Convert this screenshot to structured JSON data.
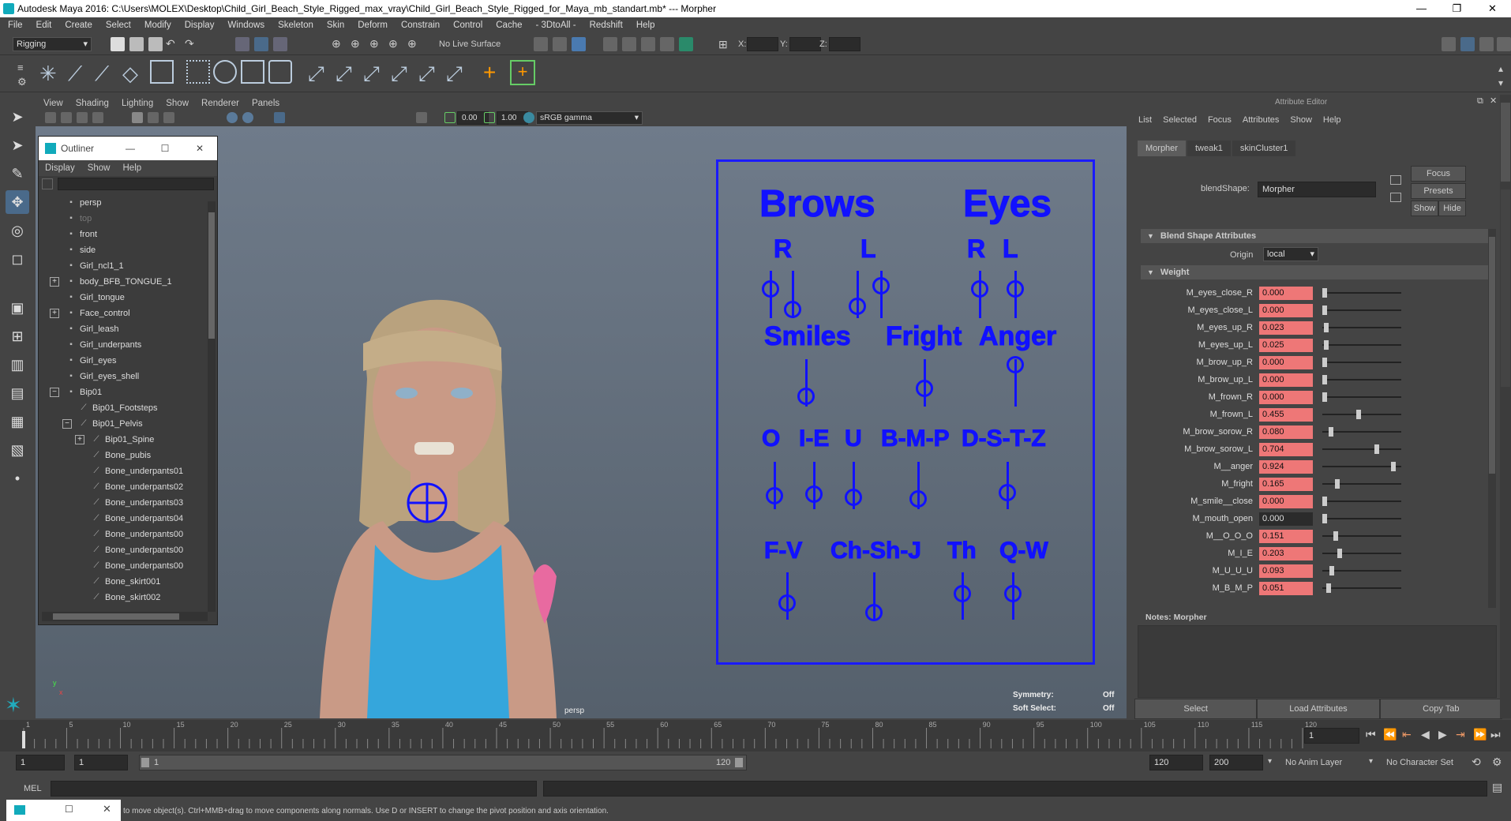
{
  "window": {
    "title": "Autodesk Maya 2016: C:\\Users\\MOLEX\\Desktop\\Child_Girl_Beach_Style_Rigged_max_vray\\Child_Girl_Beach_Style_Rigged_for_Maya_mb_standart.mb*  ---  Morpher"
  },
  "menubar": [
    "File",
    "Edit",
    "Create",
    "Select",
    "Modify",
    "Display",
    "Windows",
    "Skeleton",
    "Skin",
    "Deform",
    "Constrain",
    "Control",
    "Cache",
    "- 3DtoAll -",
    "Redshift",
    "Help"
  ],
  "statusline": {
    "mode": "Rigging",
    "live_surface": "No Live Surface",
    "x_label": "X:",
    "y_label": "Y:",
    "z_label": "Z:"
  },
  "viewport": {
    "menu": [
      "View",
      "Shading",
      "Lighting",
      "Show",
      "Renderer",
      "Panels"
    ],
    "near_value": "0.00",
    "far_value": "1.00",
    "color_space": "sRGB gamma",
    "camera_label": "persp",
    "symmetry_label": "Symmetry:",
    "symmetry_value": "Off",
    "soft_select_label": "Soft Select:",
    "soft_select_value": "Off",
    "axis_x": "x",
    "axis_y": "y"
  },
  "outliner": {
    "title": "Outliner",
    "menu": [
      "Display",
      "Show",
      "Help"
    ],
    "items": [
      {
        "label": "persp",
        "indent": 0
      },
      {
        "label": "top",
        "indent": 0,
        "dim": true
      },
      {
        "label": "front",
        "indent": 0
      },
      {
        "label": "side",
        "indent": 0
      },
      {
        "label": "Girl_ncl1_1",
        "indent": 0
      },
      {
        "label": "body_BFB_TONGUE_1",
        "indent": 0,
        "expand": "+"
      },
      {
        "label": "Girl_tongue",
        "indent": 0
      },
      {
        "label": "Face_control",
        "indent": 0,
        "expand": "+"
      },
      {
        "label": "Girl_leash",
        "indent": 0
      },
      {
        "label": "Girl_underpants",
        "indent": 0
      },
      {
        "label": "Girl_eyes",
        "indent": 0
      },
      {
        "label": "Girl_eyes_shell",
        "indent": 0
      },
      {
        "label": "Bip01",
        "indent": 0,
        "expand": "−"
      },
      {
        "label": "Bip01_Footsteps",
        "indent": 1
      },
      {
        "label": "Bip01_Pelvis",
        "indent": 1,
        "expand": "−"
      },
      {
        "label": "Bip01_Spine",
        "indent": 2,
        "expand": "+"
      },
      {
        "label": "Bone_pubis",
        "indent": 2
      },
      {
        "label": "Bone_underpants01",
        "indent": 2
      },
      {
        "label": "Bone_underpants02",
        "indent": 2
      },
      {
        "label": "Bone_underpants03",
        "indent": 2
      },
      {
        "label": "Bone_underpants04",
        "indent": 2
      },
      {
        "label": "Bone_underpants00",
        "indent": 2
      },
      {
        "label": "Bone_underpants00",
        "indent": 2
      },
      {
        "label": "Bone_underpants00",
        "indent": 2
      },
      {
        "label": "Bone_skirt001",
        "indent": 2
      },
      {
        "label": "Bone_skirt002",
        "indent": 2
      }
    ]
  },
  "control_board": {
    "brows": "Brows",
    "eyes": "Eyes",
    "r": "R",
    "l": "L",
    "smiles": "Smiles",
    "fright": "Fright",
    "anger": "Anger",
    "o": "O",
    "ie": "I-E",
    "u": "U",
    "bmp": "B-M-P",
    "dstz": "D-S-T-Z",
    "fv": "F-V",
    "chshj": "Ch-Sh-J",
    "th": "Th",
    "qw": "Q-W"
  },
  "attribute_editor": {
    "header": "Attribute Editor",
    "menu": [
      "List",
      "Selected",
      "Focus",
      "Attributes",
      "Show",
      "Help"
    ],
    "tabs": [
      "Morpher",
      "tweak1",
      "skinCluster1"
    ],
    "blendshape_label": "blendShape:",
    "blendshape_value": "Morpher",
    "focus_btn": "Focus",
    "presets_btn": "Presets",
    "show_btn": "Show",
    "hide_btn": "Hide",
    "section_blend": "Blend Shape Attributes",
    "origin_label": "Origin",
    "origin_value": "local",
    "section_weight": "Weight",
    "weights": [
      {
        "name": "M_eyes_close_R",
        "value": "0.000",
        "level": 0.0
      },
      {
        "name": "M_eyes_close_L",
        "value": "0.000",
        "level": 0.0
      },
      {
        "name": "M_eyes_up_R",
        "value": "0.023",
        "level": 0.023
      },
      {
        "name": "M_eyes_up_L",
        "value": "0.025",
        "level": 0.025
      },
      {
        "name": "M_brow_up_R",
        "value": "0.000",
        "level": 0.0
      },
      {
        "name": "M_brow_up_L",
        "value": "0.000",
        "level": 0.0
      },
      {
        "name": "M_frown_R",
        "value": "0.000",
        "level": 0.0
      },
      {
        "name": "M_frown_L",
        "value": "0.455",
        "level": 0.455
      },
      {
        "name": "M_brow_sorow_R",
        "value": "0.080",
        "level": 0.08
      },
      {
        "name": "M_brow_sorow_L",
        "value": "0.704",
        "level": 0.704
      },
      {
        "name": "M__anger",
        "value": "0.924",
        "level": 0.924
      },
      {
        "name": "M_fright",
        "value": "0.165",
        "level": 0.165
      },
      {
        "name": "M_smile__close",
        "value": "0.000",
        "level": 0.0
      },
      {
        "name": "M_mouth_open",
        "value": "0.000",
        "level": 0.0,
        "dark": true
      },
      {
        "name": "M__O_O_O",
        "value": "0.151",
        "level": 0.151
      },
      {
        "name": "M_I_E",
        "value": "0.203",
        "level": 0.203
      },
      {
        "name": "M_U_U_U",
        "value": "0.093",
        "level": 0.093
      },
      {
        "name": "M_B_M_P",
        "value": "0.051",
        "level": 0.051
      }
    ],
    "notes_label": "Notes: Morpher",
    "select_btn": "Select",
    "load_btn": "Load Attributes",
    "copy_btn": "Copy Tab"
  },
  "timeline": {
    "ticks": [
      "1",
      "5",
      "10",
      "15",
      "20",
      "25",
      "30",
      "35",
      "40",
      "45",
      "50",
      "55",
      "60",
      "65",
      "70",
      "75",
      "80",
      "85",
      "90",
      "95",
      "100",
      "105",
      "110",
      "115",
      "120"
    ],
    "current_frame": "1",
    "range_start": "1",
    "range_inner_start": "1",
    "range_slider_start": "1",
    "range_slider_end": "120",
    "range_end": "120",
    "anim_end": "200",
    "anim_layer": "No Anim Layer",
    "character_set": "No Character Set"
  },
  "command": {
    "mel_label": "MEL"
  },
  "helpline": {
    "text": "to move object(s). Ctrl+MMB+drag to move components along normals. Use D or INSERT to change the pivot position and axis orientation."
  },
  "colors": {
    "accent": "#1111ff",
    "weight_field": "#e77777",
    "bg": "#444444"
  }
}
